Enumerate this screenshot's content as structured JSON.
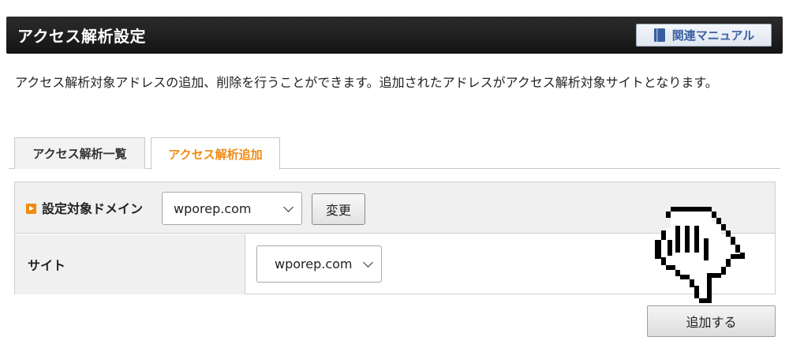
{
  "header": {
    "title": "アクセス解析設定",
    "manual_label": "関連マニュアル"
  },
  "description": "アクセス解析対象アドレスの追加、削除を行うことができます。追加されたアドレスがアクセス解析対象サイトとなります。",
  "tabs": [
    {
      "label": "アクセス解析一覧",
      "active": false
    },
    {
      "label": "アクセス解析追加",
      "active": true
    }
  ],
  "form": {
    "domain_label": "設定対象ドメイン",
    "domain_value": "wporep.com",
    "change_label": "変更",
    "site_label": "サイト",
    "site_value": "wporep.com"
  },
  "actions": {
    "add_label": "追加する"
  },
  "colors": {
    "accent": "#f08b10",
    "manual_text": "#3a5fa0",
    "header_bg": "#1c1c1c"
  },
  "icons": [
    "book-icon",
    "play-arrow-icon",
    "chevron-down-icon",
    "pointer-hand-icon"
  ]
}
